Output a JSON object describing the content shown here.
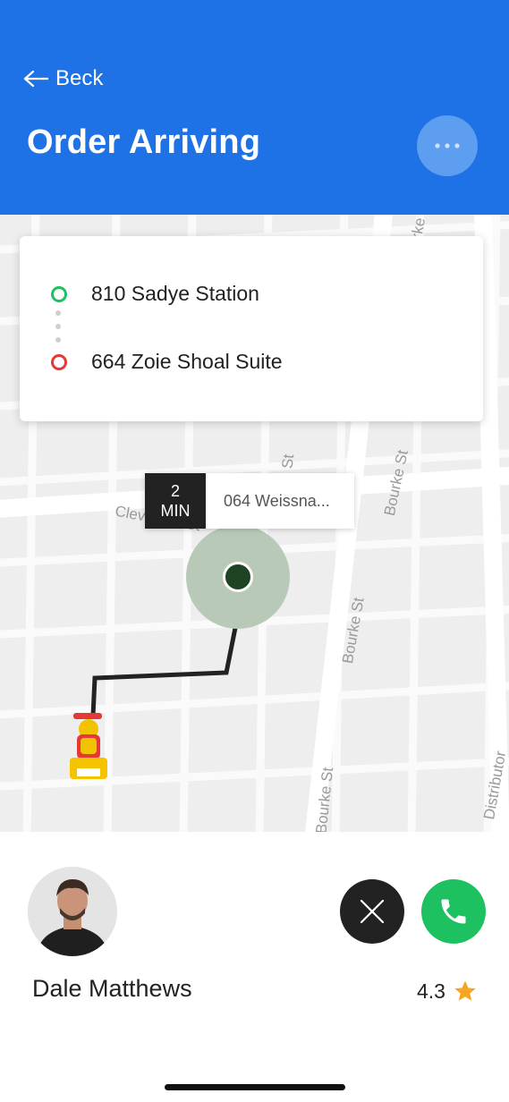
{
  "header": {
    "back_label": "Beck",
    "title": "Order Arriving",
    "accent_color": "#1f72e6"
  },
  "route": {
    "origin": "810 Sadye Station",
    "destination": "664 Zoie Shoal Suite"
  },
  "eta": {
    "minutes": "2",
    "unit": "MIN",
    "address": "064 Weissna..."
  },
  "map": {
    "streets": [
      "Cleveland St",
      "Bourke St",
      "Bourke St",
      "Bourke St",
      "Bourke St",
      "Bourke St",
      "Distributor"
    ]
  },
  "courier": {
    "name": "Dale Matthews",
    "rating": "4.3",
    "call_color": "#1ec15f"
  },
  "icons": [
    "back-arrow-icon",
    "more-icon",
    "close-icon",
    "phone-icon",
    "star-icon",
    "courier-scooter-icon"
  ]
}
